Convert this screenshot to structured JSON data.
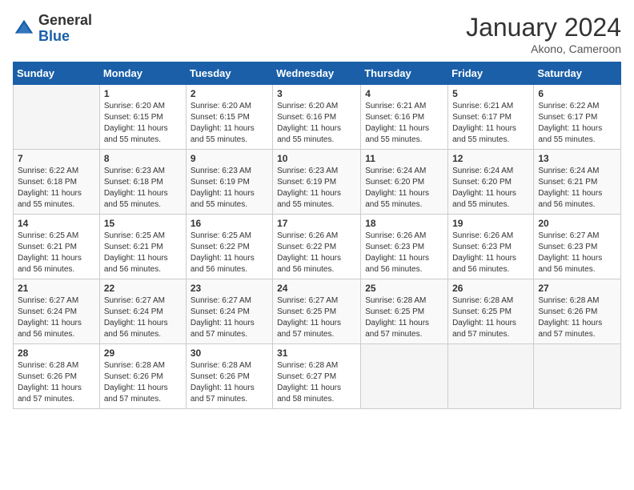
{
  "header": {
    "logo_general": "General",
    "logo_blue": "Blue",
    "month_title": "January 2024",
    "location": "Akono, Cameroon"
  },
  "weekdays": [
    "Sunday",
    "Monday",
    "Tuesday",
    "Wednesday",
    "Thursday",
    "Friday",
    "Saturday"
  ],
  "weeks": [
    [
      {
        "day": "",
        "info": ""
      },
      {
        "day": "1",
        "info": "Sunrise: 6:20 AM\nSunset: 6:15 PM\nDaylight: 11 hours\nand 55 minutes."
      },
      {
        "day": "2",
        "info": "Sunrise: 6:20 AM\nSunset: 6:15 PM\nDaylight: 11 hours\nand 55 minutes."
      },
      {
        "day": "3",
        "info": "Sunrise: 6:20 AM\nSunset: 6:16 PM\nDaylight: 11 hours\nand 55 minutes."
      },
      {
        "day": "4",
        "info": "Sunrise: 6:21 AM\nSunset: 6:16 PM\nDaylight: 11 hours\nand 55 minutes."
      },
      {
        "day": "5",
        "info": "Sunrise: 6:21 AM\nSunset: 6:17 PM\nDaylight: 11 hours\nand 55 minutes."
      },
      {
        "day": "6",
        "info": "Sunrise: 6:22 AM\nSunset: 6:17 PM\nDaylight: 11 hours\nand 55 minutes."
      }
    ],
    [
      {
        "day": "7",
        "info": "Sunrise: 6:22 AM\nSunset: 6:18 PM\nDaylight: 11 hours\nand 55 minutes."
      },
      {
        "day": "8",
        "info": "Sunrise: 6:23 AM\nSunset: 6:18 PM\nDaylight: 11 hours\nand 55 minutes."
      },
      {
        "day": "9",
        "info": "Sunrise: 6:23 AM\nSunset: 6:19 PM\nDaylight: 11 hours\nand 55 minutes."
      },
      {
        "day": "10",
        "info": "Sunrise: 6:23 AM\nSunset: 6:19 PM\nDaylight: 11 hours\nand 55 minutes."
      },
      {
        "day": "11",
        "info": "Sunrise: 6:24 AM\nSunset: 6:20 PM\nDaylight: 11 hours\nand 55 minutes."
      },
      {
        "day": "12",
        "info": "Sunrise: 6:24 AM\nSunset: 6:20 PM\nDaylight: 11 hours\nand 55 minutes."
      },
      {
        "day": "13",
        "info": "Sunrise: 6:24 AM\nSunset: 6:21 PM\nDaylight: 11 hours\nand 56 minutes."
      }
    ],
    [
      {
        "day": "14",
        "info": "Sunrise: 6:25 AM\nSunset: 6:21 PM\nDaylight: 11 hours\nand 56 minutes."
      },
      {
        "day": "15",
        "info": "Sunrise: 6:25 AM\nSunset: 6:21 PM\nDaylight: 11 hours\nand 56 minutes."
      },
      {
        "day": "16",
        "info": "Sunrise: 6:25 AM\nSunset: 6:22 PM\nDaylight: 11 hours\nand 56 minutes."
      },
      {
        "day": "17",
        "info": "Sunrise: 6:26 AM\nSunset: 6:22 PM\nDaylight: 11 hours\nand 56 minutes."
      },
      {
        "day": "18",
        "info": "Sunrise: 6:26 AM\nSunset: 6:23 PM\nDaylight: 11 hours\nand 56 minutes."
      },
      {
        "day": "19",
        "info": "Sunrise: 6:26 AM\nSunset: 6:23 PM\nDaylight: 11 hours\nand 56 minutes."
      },
      {
        "day": "20",
        "info": "Sunrise: 6:27 AM\nSunset: 6:23 PM\nDaylight: 11 hours\nand 56 minutes."
      }
    ],
    [
      {
        "day": "21",
        "info": "Sunrise: 6:27 AM\nSunset: 6:24 PM\nDaylight: 11 hours\nand 56 minutes."
      },
      {
        "day": "22",
        "info": "Sunrise: 6:27 AM\nSunset: 6:24 PM\nDaylight: 11 hours\nand 56 minutes."
      },
      {
        "day": "23",
        "info": "Sunrise: 6:27 AM\nSunset: 6:24 PM\nDaylight: 11 hours\nand 57 minutes."
      },
      {
        "day": "24",
        "info": "Sunrise: 6:27 AM\nSunset: 6:25 PM\nDaylight: 11 hours\nand 57 minutes."
      },
      {
        "day": "25",
        "info": "Sunrise: 6:28 AM\nSunset: 6:25 PM\nDaylight: 11 hours\nand 57 minutes."
      },
      {
        "day": "26",
        "info": "Sunrise: 6:28 AM\nSunset: 6:25 PM\nDaylight: 11 hours\nand 57 minutes."
      },
      {
        "day": "27",
        "info": "Sunrise: 6:28 AM\nSunset: 6:26 PM\nDaylight: 11 hours\nand 57 minutes."
      }
    ],
    [
      {
        "day": "28",
        "info": "Sunrise: 6:28 AM\nSunset: 6:26 PM\nDaylight: 11 hours\nand 57 minutes."
      },
      {
        "day": "29",
        "info": "Sunrise: 6:28 AM\nSunset: 6:26 PM\nDaylight: 11 hours\nand 57 minutes."
      },
      {
        "day": "30",
        "info": "Sunrise: 6:28 AM\nSunset: 6:26 PM\nDaylight: 11 hours\nand 57 minutes."
      },
      {
        "day": "31",
        "info": "Sunrise: 6:28 AM\nSunset: 6:27 PM\nDaylight: 11 hours\nand 58 minutes."
      },
      {
        "day": "",
        "info": ""
      },
      {
        "day": "",
        "info": ""
      },
      {
        "day": "",
        "info": ""
      }
    ]
  ]
}
